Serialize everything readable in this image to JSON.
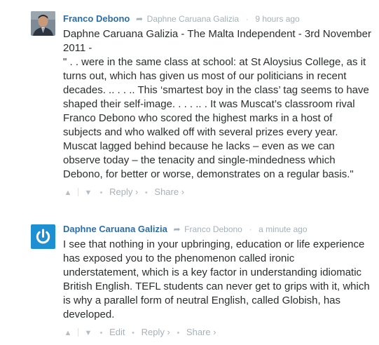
{
  "comments": [
    {
      "author": "Franco Debono",
      "reply_to": "Daphne Caruana Galizia",
      "timestamp": "9 hours ago",
      "text": [
        "Daphne Caruana Galizia - The Malta Independent - 3rd November 2011 -",
        "\" . . were in the same class at school: at St Aloysius College, as it turns out, which has given us most of our politicians in recent decades. .. . . .. This ‘smartest boy in the class’ tag seems to have shaped their self-image. . . . .. . It was Muscat’s classroom rival Franco Debono who scored the highest marks in a host of subjects and who walked off with several prizes every year. Muscat lagged behind because he lacks – even as we can observe today – the tenacity and single-mindedness which Debono, for better or worse, demonstrates on a regular basis.\""
      ],
      "actions": {
        "reply": "Reply ›",
        "share": "Share ›"
      }
    },
    {
      "author": "Daphne Caruana Galizia",
      "reply_to": "Franco Debono",
      "timestamp": "a minute ago",
      "text": [
        "I see that nothing in your upbringing, education or life experience has exposed you to the phenomenon called ironic understatement, which is a key factor in understanding idiomatic British English. TEFL students can never get to grips with it, which is why a parallel form of neutral English, called Globish, has developed."
      ],
      "actions": {
        "edit": "Edit",
        "reply": "Reply ›",
        "share": "Share ›"
      }
    }
  ],
  "icons": {
    "upvote": "chevron-up-icon",
    "downvote": "chevron-down-icon",
    "reply_arrow": "reply-arrow-icon"
  },
  "colors": {
    "author_link": "#2e6da4",
    "meta_gray": "#a5b2b9",
    "text": "#2a2e2e",
    "avatar2_bg": "#1e8fd0"
  }
}
